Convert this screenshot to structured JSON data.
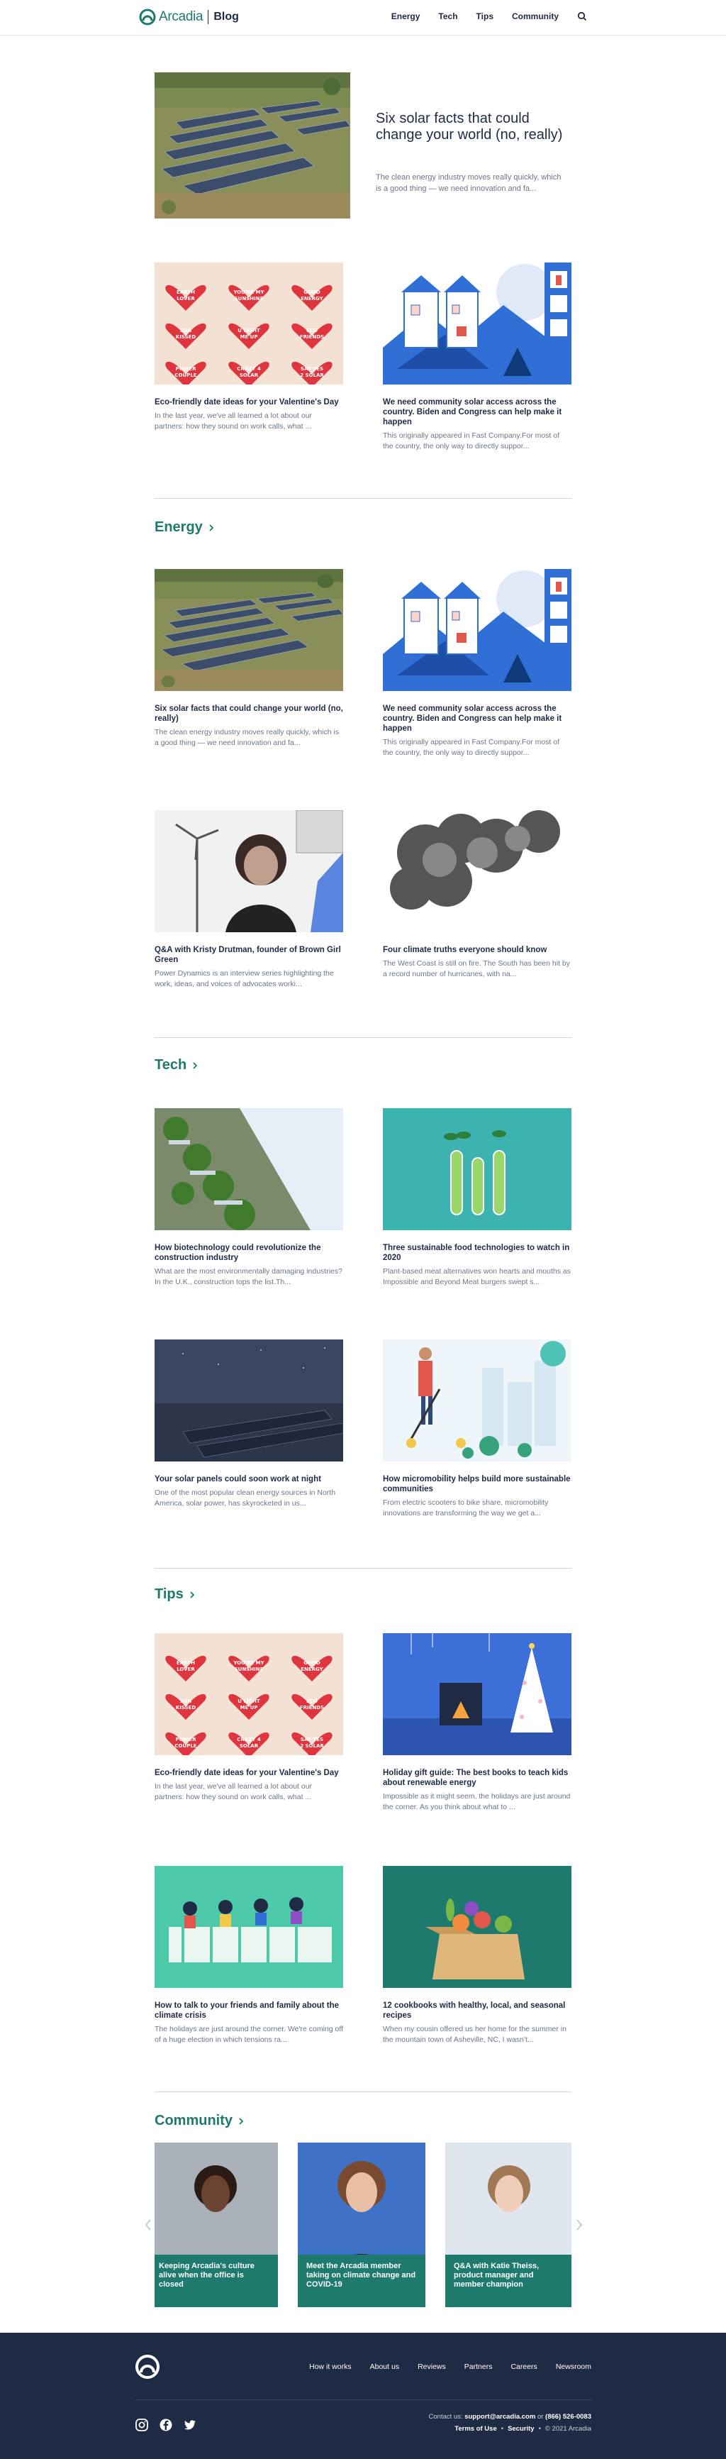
{
  "header": {
    "brand": "Arcadia",
    "section": "Blog",
    "nav": [
      "Energy",
      "Tech",
      "Tips",
      "Community"
    ]
  },
  "hero": {
    "title": "Six solar facts that could change your world (no, really)",
    "excerpt": "The clean energy industry moves really quickly, which is a good thing — we need innovation and fa..."
  },
  "featured": [
    {
      "title": "Eco-friendly date ideas for your Valentine's Day",
      "excerpt": "In the last year, we've all learned a lot about our partners: how they sound on work calls, what ..."
    },
    {
      "title": "We need community solar access across the country. Biden and Congress can help make it happen",
      "excerpt": "This originally appeared in Fast Company.For most of the country, the only way to directly suppor..."
    }
  ],
  "sections": {
    "energy": {
      "title": "Energy",
      "cards": [
        {
          "title": "Six solar facts that could change your world (no, really)",
          "excerpt": "The clean energy industry moves really quickly, which is a good thing — we need innovation and fa..."
        },
        {
          "title": "We need community solar access across the country. Biden and Congress can help make it happen",
          "excerpt": "This originally appeared in Fast Company.For most of the country, the only way to directly suppor..."
        },
        {
          "title": "Q&A with Kristy Drutman, founder of Brown Girl Green",
          "excerpt": "Power Dynamics is an interview series highlighting the work, ideas, and voices of advocates worki..."
        },
        {
          "title": "Four climate truths everyone should know",
          "excerpt": "The West Coast is still on fire. The South has been hit by a record number of hurricanes, with na..."
        }
      ]
    },
    "tech": {
      "title": "Tech",
      "cards": [
        {
          "title": "How biotechnology could revolutionize the construction industry",
          "excerpt": "What are the most environmentally damaging industries? In the U.K., construction tops the list.Th..."
        },
        {
          "title": "Three sustainable food technologies to watch in 2020",
          "excerpt": "Plant-based meat alternatives won hearts and mouths as Impossible and Beyond Meat burgers swept s..."
        },
        {
          "title": "Your solar panels could soon work at night",
          "excerpt": "One of the most popular clean energy sources in North America, solar power, has skyrocketed in us..."
        },
        {
          "title": "How micromobility helps build more sustainable communities",
          "excerpt": "From electric scooters to bike share, micromobility innovations are transforming the way we get a..."
        }
      ]
    },
    "tips": {
      "title": "Tips",
      "cards": [
        {
          "title": "Eco-friendly date ideas for your Valentine's Day",
          "excerpt": "In the last year, we've all learned a lot about our partners: how they sound on work calls, what ..."
        },
        {
          "title": "Holiday gift guide: The best books to teach kids about renewable energy",
          "excerpt": "Impossible as it might seem, the holidays are just around the corner. As you think about what to ..."
        },
        {
          "title": "How to talk to your friends and family about the climate crisis",
          "excerpt": "The holidays are just around the corner. We're coming off of a huge election in which tensions ra..."
        },
        {
          "title": "12 cookbooks with healthy, local, and seasonal recipes",
          "excerpt": "When my cousin offered us her home for the summer in the mountain town of Asheville, NC, I wasn't..."
        }
      ]
    },
    "community": {
      "title": "Community",
      "cards": [
        {
          "title": "Keeping Arcadia's culture alive when the office is closed"
        },
        {
          "title": "Meet the Arcadia member taking on climate change and COVID-19"
        },
        {
          "title": "Q&A with Katie Theiss, product manager and member champion"
        }
      ]
    }
  },
  "hearts": [
    "EARTH LOVER",
    "YOU'RE MY SUNSHINE",
    "GOOD ENERGY",
    "SUN KISSED",
    "U LIGHT ME UP",
    "ECO FRIENDS",
    "POWER COUPLE",
    "CRAZY 4 SOLAR",
    "SAY YES 2 SOLAR"
  ],
  "footer": {
    "links": [
      "How it works",
      "About us",
      "Reviews",
      "Partners",
      "Careers",
      "Newsroom"
    ],
    "contact_prefix": "Contact us:",
    "email": "support@arcadia.com",
    "or": "or",
    "phone": "(866) 526-0083",
    "terms": "Terms of Use",
    "security": "Security",
    "copyright": "© 2021 Arcadia"
  },
  "colors": {
    "brand": "#1e7a6c",
    "navy": "#1f2a44",
    "muted": "#6c7688"
  }
}
